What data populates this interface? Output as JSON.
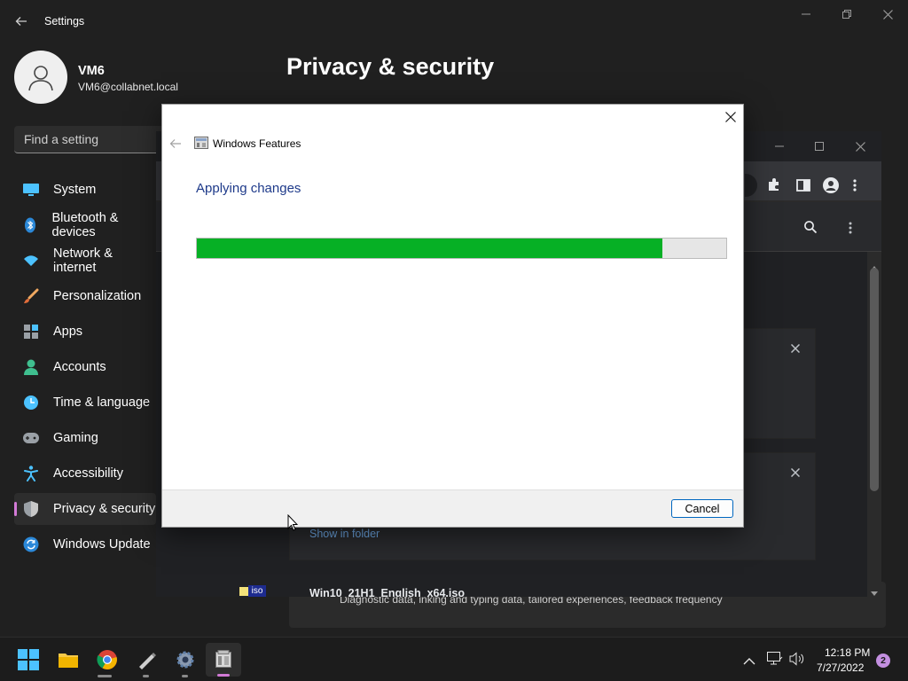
{
  "settings": {
    "title": "Settings",
    "user_name": "VM6",
    "user_email": "VM6@collabnet.local",
    "search_placeholder": "Find a setting",
    "page_title": "Privacy & security",
    "nav": [
      {
        "label": "System",
        "icon": "monitor-icon"
      },
      {
        "label": "Bluetooth & devices",
        "icon": "bluetooth-icon"
      },
      {
        "label": "Network & internet",
        "icon": "wifi-icon"
      },
      {
        "label": "Personalization",
        "icon": "brush-icon"
      },
      {
        "label": "Apps",
        "icon": "apps-icon"
      },
      {
        "label": "Accounts",
        "icon": "person-icon"
      },
      {
        "label": "Time & language",
        "icon": "clock-icon"
      },
      {
        "label": "Gaming",
        "icon": "gamepad-icon"
      },
      {
        "label": "Accessibility",
        "icon": "accessibility-icon"
      },
      {
        "label": "Privacy & security",
        "icon": "shield-icon"
      },
      {
        "label": "Windows Update",
        "icon": "update-icon"
      }
    ],
    "bottom_text": "Diagnostic data, inking and typing data, tailored experiences, feedback frequency"
  },
  "chrome": {
    "show_in_folder": "Show in folder",
    "download_name": "Win10_21H1_English_x64.iso",
    "file_badge": "iso"
  },
  "dialog": {
    "title": "Windows Features",
    "heading": "Applying changes",
    "progress": 0.88,
    "cancel_label": "Cancel"
  },
  "taskbar": {
    "time": "12:18 PM",
    "date": "7/27/2022",
    "notification_count": "2"
  },
  "colors": {
    "progress_fill": "#06b025",
    "accent": "#d27ad6",
    "link": "#6ea8e6"
  }
}
